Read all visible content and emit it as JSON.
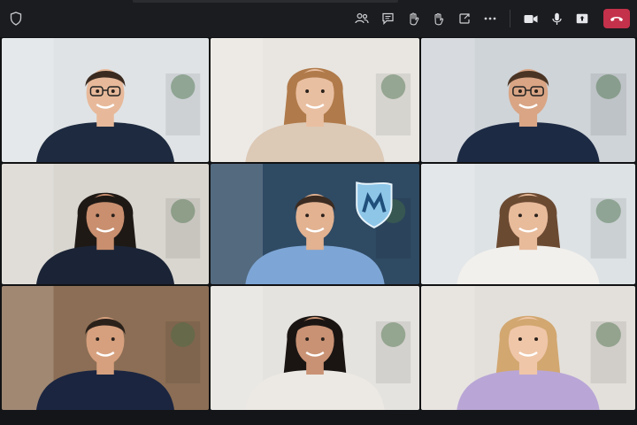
{
  "toolbar": {
    "left_icon": "shield-outline-icon",
    "buttons": [
      {
        "id": "people",
        "icon": "people-icon"
      },
      {
        "id": "chat",
        "icon": "chat-icon"
      },
      {
        "id": "raise-hand",
        "icon": "hand-icon"
      },
      {
        "id": "react",
        "icon": "react-icon"
      },
      {
        "id": "share",
        "icon": "share-tray-icon"
      },
      {
        "id": "more",
        "icon": "more-dots-icon"
      },
      {
        "id": "camera",
        "icon": "camera-icon"
      },
      {
        "id": "mic",
        "icon": "microphone-icon"
      },
      {
        "id": "share-screen",
        "icon": "screen-share-icon"
      }
    ],
    "hangup": {
      "icon": "phone-hangup-icon",
      "color": "#c4314b"
    }
  },
  "colors": {
    "toolbar_bg": "#1b1c1f",
    "app_bg": "#111214",
    "hangup": "#c4314b",
    "brand_shield": "#8ec6e8"
  },
  "participants": [
    {
      "row": 1,
      "col": 1,
      "shirt": "#1d2a3f",
      "wall": "#dfe3e6",
      "glasses": true
    },
    {
      "row": 1,
      "col": 2,
      "shirt": "#dcc9b6",
      "wall": "#e9e6e1",
      "glasses": false
    },
    {
      "row": 1,
      "col": 3,
      "shirt": "#1d2a44",
      "wall": "#cfd4d8",
      "glasses": true
    },
    {
      "row": 2,
      "col": 1,
      "shirt": "#1b2436",
      "wall": "#d9d6d0",
      "glasses": false
    },
    {
      "row": 2,
      "col": 2,
      "shirt": "#7da6d6",
      "wall": "#2f4a63",
      "glasses": false,
      "has_logo": true
    },
    {
      "row": 2,
      "col": 3,
      "shirt": "#f2f0ec",
      "wall": "#dde2e5",
      "glasses": false
    },
    {
      "row": 3,
      "col": 1,
      "shirt": "#1b2540",
      "wall": "#8b6e55",
      "glasses": false
    },
    {
      "row": 3,
      "col": 2,
      "shirt": "#ece9e4",
      "wall": "#e5e3df",
      "glasses": false
    },
    {
      "row": 3,
      "col": 3,
      "shirt": "#b9a6d6",
      "wall": "#e3e0db",
      "glasses": false
    }
  ]
}
